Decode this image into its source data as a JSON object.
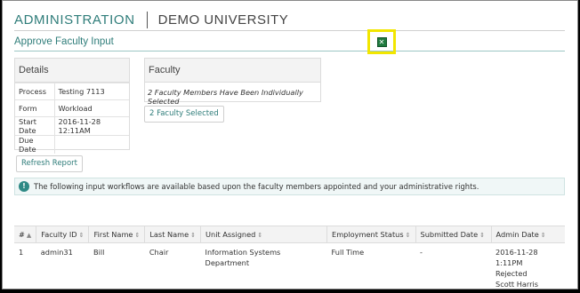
{
  "header": {
    "brand": "ADMINISTRATION",
    "org": "DEMO UNIVERSITY"
  },
  "page": {
    "title": "Approve Faculty Input"
  },
  "export": {
    "icon": "excel-icon"
  },
  "details": {
    "title": "Details",
    "rows": [
      {
        "label": "Process",
        "value": "Testing 7113"
      },
      {
        "label": "Form",
        "value": "Workload"
      },
      {
        "label": "Start Date",
        "value": "2016-11-28 12:11AM"
      },
      {
        "label": "Due Date",
        "value": ""
      }
    ]
  },
  "faculty": {
    "title": "Faculty",
    "summary": "2 Faculty Members Have Been Individually Selected",
    "button_label": "2 Faculty Selected"
  },
  "refresh": {
    "label": "Refresh Report"
  },
  "info": {
    "text": "The following input workflows are available based upon the faculty members appointed and your administrative rights."
  },
  "table": {
    "columns": [
      "#",
      "Faculty ID",
      "First Name",
      "Last Name",
      "Unit Assigned",
      "Employment Status",
      "Submitted Date",
      "Admin Date"
    ],
    "sort_indicators": [
      "▲",
      "⇕",
      "⇕",
      "⇕",
      "⇕",
      "⇕",
      "⇕",
      "⇕"
    ],
    "rows": [
      {
        "num": "1",
        "faculty_id": "admin31",
        "first_name": "Bill",
        "last_name": "Chair",
        "unit": "Information Systems Department",
        "employment_status": "Full Time",
        "submitted_date": "-",
        "admin_date": "2016-11-28 1:11PM",
        "admin_status": "Rejected",
        "admin_by": "Scott Harris"
      }
    ]
  }
}
